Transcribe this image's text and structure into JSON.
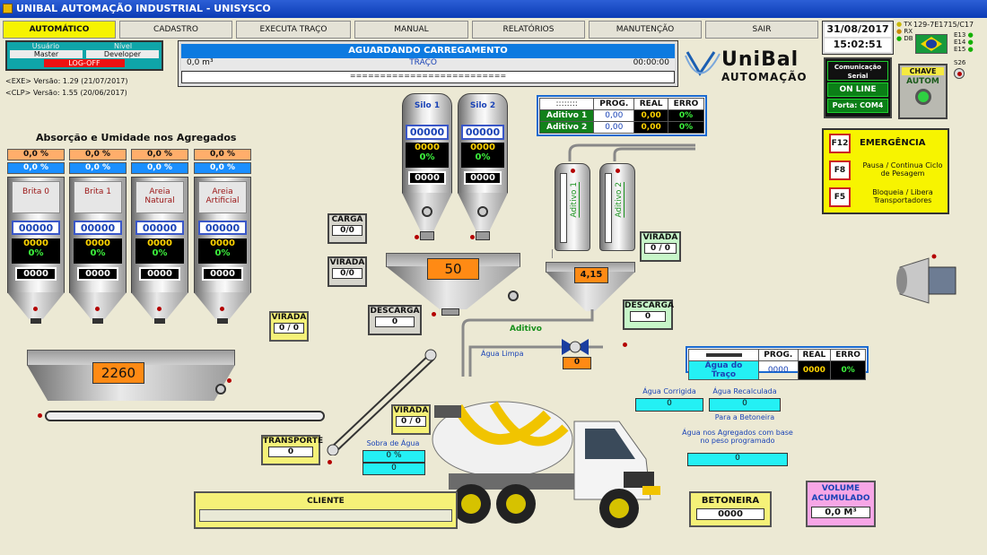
{
  "window": {
    "title": "UNIBAL AUTOMAÇÃO INDUSTRIAL - UNISYSCO"
  },
  "menu": [
    "AUTOMÁTICO",
    "CADASTRO",
    "EXECUTA TRAÇO",
    "MANUAL",
    "RELATÓRIOS",
    "MANUTENÇÃO",
    "SAIR"
  ],
  "header": {
    "date": "31/08/2017",
    "time": "15:02:51",
    "tx": "TX",
    "rx": "RX",
    "db": "DB",
    "code": "129-7E1715/C17",
    "e13": "E13",
    "e14": "E14",
    "e15": "E15",
    "s26": "S26"
  },
  "user": {
    "usuario_label": "Usuário",
    "nivel_label": "Nível",
    "usuario": "Master",
    "nivel": "Developer",
    "logoff": "LOG-OFF"
  },
  "versions": {
    "exe": "<EXE> Versão: 1.29 (21/07/2017)",
    "clp": "<CLP> Versão: 1.55 (20/06/2017)"
  },
  "status": {
    "title": "AGUARDANDO CARREGAMENTO",
    "volume": "0,0 m³",
    "trace": "TRAÇO",
    "timer": "00:00:00",
    "bar": "=========================="
  },
  "brand": {
    "name": "UniBal",
    "sub": "AUTOMAÇÃO"
  },
  "comm": {
    "title": "Comunicação Serial",
    "state": "ON LINE",
    "port": "Porta: COM4"
  },
  "chave": {
    "title": "CHAVE",
    "mode": "AUTOM"
  },
  "emergency": {
    "title": "EMERGÊNCIA",
    "items": [
      {
        "key": "F12",
        "label": ""
      },
      {
        "key": "F8",
        "label": "Pausa / Continua Ciclo de Pesagem"
      },
      {
        "key": "F5",
        "label": "Bloqueia / Libera Transportadores"
      }
    ]
  },
  "absorcao": {
    "title": "Absorção e Umidade nos Agregados"
  },
  "aggregates": [
    {
      "name": "Brita 0",
      "abs": "0,0 %",
      "umid": "0,0 %",
      "setpoint": "00000",
      "weight": "0000",
      "pct": "0%",
      "real": "0000"
    },
    {
      "name": "Brita 1",
      "abs": "0,0 %",
      "umid": "0,0 %",
      "setpoint": "00000",
      "weight": "0000",
      "pct": "0%",
      "real": "0000"
    },
    {
      "name": "Areia Natural",
      "abs": "0,0 %",
      "umid": "0,0 %",
      "setpoint": "00000",
      "weight": "0000",
      "pct": "0%",
      "real": "0000"
    },
    {
      "name": "Areia Artificial",
      "abs": "0,0 %",
      "umid": "0,0 %",
      "setpoint": "00000",
      "weight": "0000",
      "pct": "0%",
      "real": "0000"
    }
  ],
  "silos": [
    {
      "name": "Silo 1",
      "setpoint": "00000",
      "weight": "0000",
      "pct": "0%",
      "real": "0000"
    },
    {
      "name": "Silo 2",
      "setpoint": "00000",
      "weight": "0000",
      "pct": "0%",
      "real": "0000"
    }
  ],
  "aditivos": {
    "header": [
      "::::::::",
      "PROG.",
      "REAL",
      "ERRO"
    ],
    "rows": [
      {
        "name": "Aditivo 1",
        "prog": "0,00",
        "real": "0,00",
        "erro": "0%"
      },
      {
        "name": "Aditivo 2",
        "prog": "0,00",
        "real": "0,00",
        "erro": "0%"
      }
    ],
    "tank1": "Aditivo 1",
    "tank2": "Aditivo 2",
    "scale": "4,15",
    "flow": "Aditivo"
  },
  "agua": {
    "header": [
      "",
      "PROG.",
      "REAL",
      "ERRO"
    ],
    "label": "Água do Traço",
    "prog": "0000",
    "real": "0000",
    "erro": "0%",
    "limpa": "Água Limpa",
    "valve": "0"
  },
  "balances": {
    "agregados": "2260",
    "cimento": "50"
  },
  "carga": {
    "label": "CARGA",
    "value": "0/0"
  },
  "virada_cim": {
    "label": "VIRADA",
    "value": "0/0"
  },
  "descarga_cim": {
    "label": "DESCARGA",
    "value": "0"
  },
  "virada_agr": {
    "label": "VIRADA",
    "value": "0 / 0"
  },
  "virada_adit": {
    "label": "VIRADA",
    "value": "0 / 0"
  },
  "descarga_adit": {
    "label": "DESCARGA",
    "value": "0"
  },
  "virada_transp": {
    "label": "VIRADA",
    "value": "0 / 0"
  },
  "transporte": {
    "label": "TRANSPORTE",
    "value": "0"
  },
  "sobra": {
    "label": "Sobra de Água",
    "pct": "0 %",
    "value": "0"
  },
  "agua_corrigida": {
    "label": "Água Corrigida",
    "value": "0"
  },
  "agua_recalc": {
    "label": "Água Recalculada",
    "value": "0",
    "sub": "Para a Betoneira"
  },
  "agua_agreg": {
    "label": "Água nos Agregados com base no peso programado",
    "value": "0"
  },
  "cliente": {
    "label": "CLIENTE",
    "value": ""
  },
  "betoneira": {
    "label": "BETONEIRA",
    "value": "0000"
  },
  "volume": {
    "label": "VOLUME ACUMULADO",
    "value": "0,0 M³"
  }
}
